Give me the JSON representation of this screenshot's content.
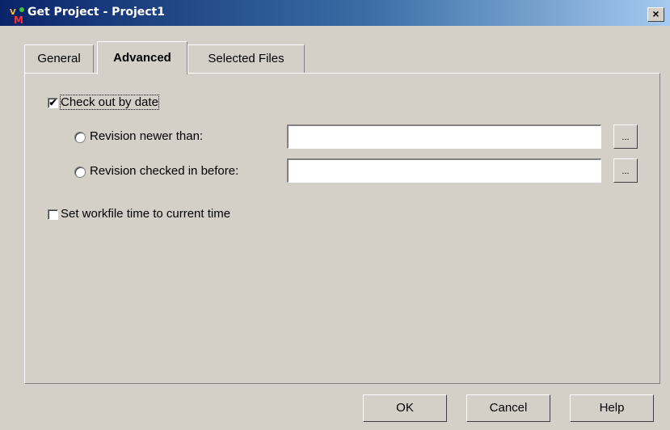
{
  "window": {
    "title": "Get Project - Project1",
    "close_label": "×",
    "icon": "vm-app-icon"
  },
  "tabs": [
    {
      "label": "General",
      "active": false
    },
    {
      "label": "Advanced",
      "active": true
    },
    {
      "label": "Selected Files",
      "active": false
    }
  ],
  "advanced": {
    "checkout_by_date": {
      "label": "Check out by date",
      "checked": true,
      "check_mark": "✔"
    },
    "revision_newer_than": {
      "label": "Revision newer than:",
      "value": "",
      "browse_label": "..."
    },
    "revision_checked_in_before": {
      "label": "Revision checked in before:",
      "value": "",
      "browse_label": "..."
    },
    "set_workfile_time": {
      "label": "Set workfile time to current time",
      "checked": false
    }
  },
  "buttons": {
    "ok": "OK",
    "cancel": "Cancel",
    "help": "Help"
  },
  "colors": {
    "title_gradient_start": "#0a246a",
    "dialog_background": "#d4d0c8"
  }
}
